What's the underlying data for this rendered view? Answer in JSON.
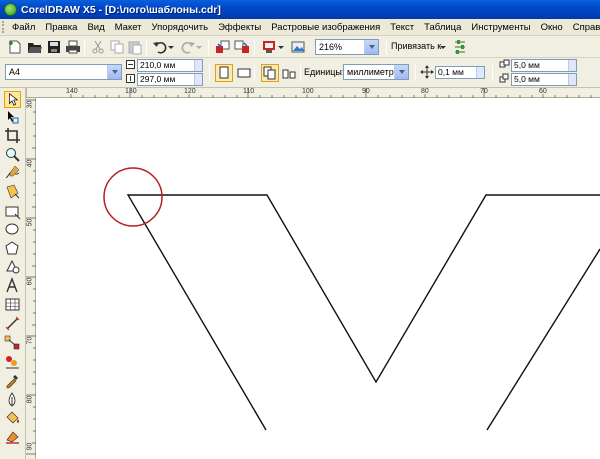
{
  "window": {
    "title": "CorelDRAW X5 - [D:\\лого\\шаблоны.cdr]"
  },
  "menu": [
    "Файл",
    "Правка",
    "Вид",
    "Макет",
    "Упорядочить",
    "Эффекты",
    "Растровые изображения",
    "Текст",
    "Таблица",
    "Инструменты",
    "Окно",
    "Справка"
  ],
  "toolbar": {
    "zoom": "216%",
    "snap_label": "Привязать к"
  },
  "property_bar": {
    "paper_size": "A4",
    "width": "210,0 мм",
    "height": "297,0 мм",
    "units_label": "Единицы:",
    "units_value": "миллиметры",
    "nudge": "0,1 мм",
    "dup_x": "5,0 мм",
    "dup_y": "5,0 мм"
  },
  "ruler_h": [
    "140",
    "130",
    "120",
    "110",
    "100",
    "90",
    "80",
    "70",
    "60"
  ],
  "ruler_v": [
    "30",
    "40",
    "50",
    "60",
    "70",
    "80",
    "90"
  ],
  "colors": {
    "titlebar": "#0048c8",
    "highlight_circle": "#b52020",
    "chrome": "#f1efe2"
  },
  "icons": [
    "new-icon",
    "open-icon",
    "save-icon",
    "print-icon",
    "cut-icon",
    "copy-icon",
    "paste-icon",
    "undo-icon",
    "redo-icon",
    "import-icon",
    "export-icon",
    "launcher-icon",
    "welcome-icon",
    "options-icon"
  ],
  "tools": [
    "pick-tool-icon",
    "shape-tool-icon",
    "crop-tool-icon",
    "zoom-tool-icon",
    "freehand-tool-icon",
    "smart-fill-icon",
    "rectangle-tool-icon",
    "ellipse-tool-icon",
    "polygon-tool-icon",
    "basic-shapes-icon",
    "text-tool-icon",
    "table-tool-icon",
    "dimension-tool-icon",
    "connector-tool-icon",
    "blend-tool-icon",
    "eyedropper-tool-icon",
    "outline-tool-icon",
    "fill-tool-icon",
    "interactive-fill-icon"
  ]
}
